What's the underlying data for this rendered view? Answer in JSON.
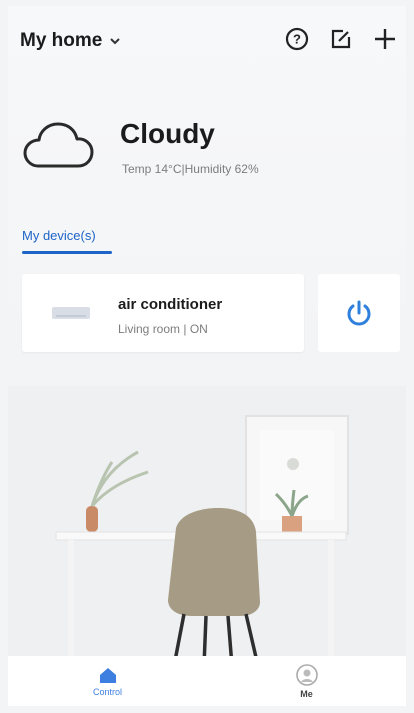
{
  "header": {
    "home_label": "My home",
    "icons": [
      "help-icon",
      "edit-icon",
      "add-icon"
    ]
  },
  "weather": {
    "condition": "Cloudy",
    "details": "Temp 14°C|Humidity 62%",
    "icon": "cloud-icon"
  },
  "tabs": [
    {
      "label": "My device(s)",
      "active": true
    }
  ],
  "devices": [
    {
      "name": "air conditioner",
      "status": "Living room | ON",
      "icon": "ac-icon"
    }
  ],
  "bottom_nav": [
    {
      "label": "Control",
      "icon": "home-icon",
      "active": true
    },
    {
      "label": "Me",
      "icon": "profile-icon",
      "active": false
    }
  ],
  "colors": {
    "accent": "#1e64c8",
    "power": "#2f7fdc",
    "nav_active": "#3d7fe0"
  }
}
